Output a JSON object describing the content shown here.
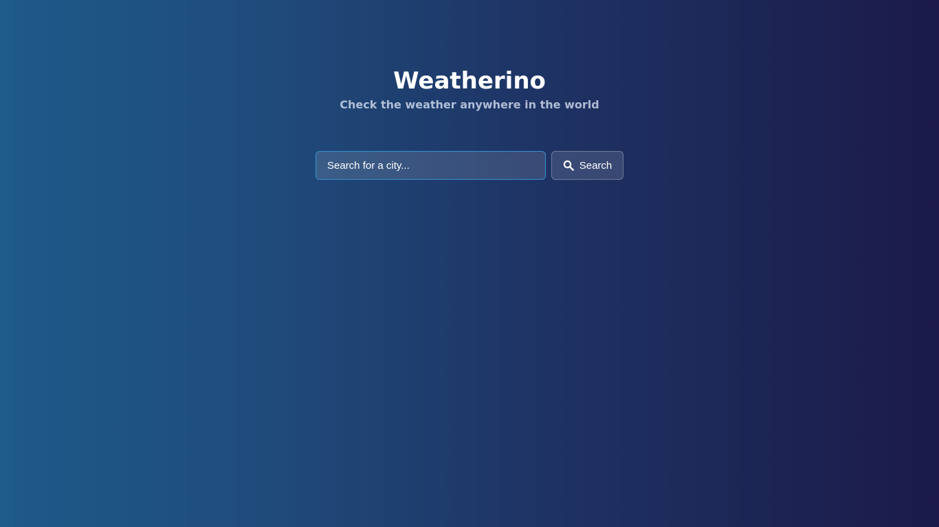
{
  "app": {
    "title": "Weatherino",
    "subtitle": "Check the weather anywhere in the world"
  },
  "search": {
    "placeholder": "Search for a city...",
    "value": "",
    "button_label": "Search",
    "button_icon": "search-icon"
  },
  "colors": {
    "background_start": "#1e5a8a",
    "background_end": "#1b1a4a",
    "input_border": "#3a8fcf",
    "text": "#ffffff"
  }
}
